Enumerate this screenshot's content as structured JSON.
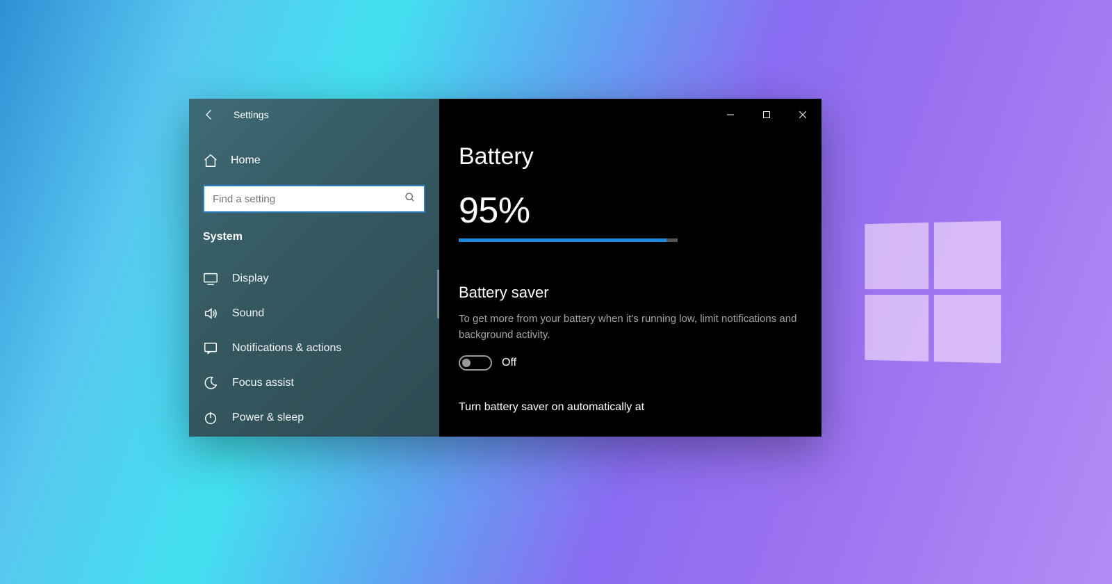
{
  "window": {
    "title": "Settings"
  },
  "sidebar": {
    "home_label": "Home",
    "search_placeholder": "Find a setting",
    "category_label": "System",
    "items": [
      {
        "label": "Display"
      },
      {
        "label": "Sound"
      },
      {
        "label": "Notifications & actions"
      },
      {
        "label": "Focus assist"
      },
      {
        "label": "Power & sleep"
      }
    ]
  },
  "content": {
    "page_title": "Battery",
    "battery_percent_text": "95%",
    "battery_percent_value": 95,
    "saver_section_title": "Battery saver",
    "saver_section_desc": "To get more from your battery when it's running low, limit notifications and background activity.",
    "saver_toggle_state": "Off",
    "auto_on_label": "Turn battery saver on automatically at"
  },
  "colors": {
    "accent": "#1b8be0",
    "focus_border": "#2f7fbf"
  }
}
